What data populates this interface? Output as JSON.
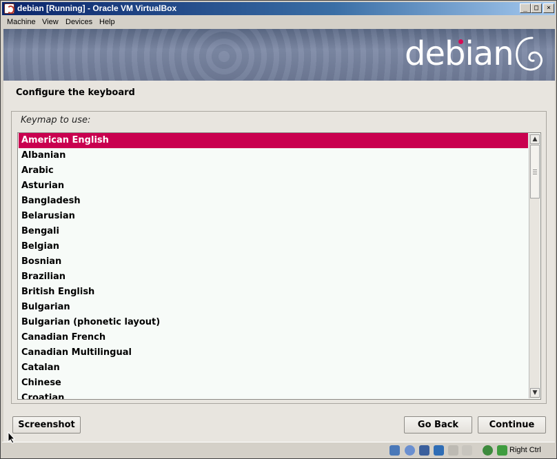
{
  "window": {
    "title": "debian [Running] - Oracle VM VirtualBox",
    "min_glyph": "_",
    "max_glyph": "□",
    "close_glyph": "×"
  },
  "menu": [
    "Machine",
    "View",
    "Devices",
    "Help"
  ],
  "banner": {
    "logo_text": "debian"
  },
  "installer": {
    "title": "Configure the keyboard",
    "group_label": "Keymap to use:",
    "selected_index": 0,
    "keymaps": [
      "American English",
      "Albanian",
      "Arabic",
      "Asturian",
      "Bangladesh",
      "Belarusian",
      "Bengali",
      "Belgian",
      "Bosnian",
      "Brazilian",
      "British English",
      "Bulgarian",
      "Bulgarian (phonetic layout)",
      "Canadian French",
      "Canadian Multilingual",
      "Catalan",
      "Chinese",
      "Croatian"
    ],
    "buttons": {
      "screenshot": "Screenshot",
      "go_back": "Go Back",
      "continue": "Continue"
    }
  },
  "statusbar": {
    "host_key": "Right Ctrl",
    "icons": [
      "hard-disk-icon",
      "optical-disk-icon",
      "usb-icon",
      "network-icon",
      "shared-folders-icon",
      "display-icon",
      "mouse-integration-icon",
      "host-key-icon"
    ]
  },
  "colors": {
    "selection": "#c9004f",
    "list_background": "#f7fbf8",
    "banner": "#6e7a96"
  }
}
